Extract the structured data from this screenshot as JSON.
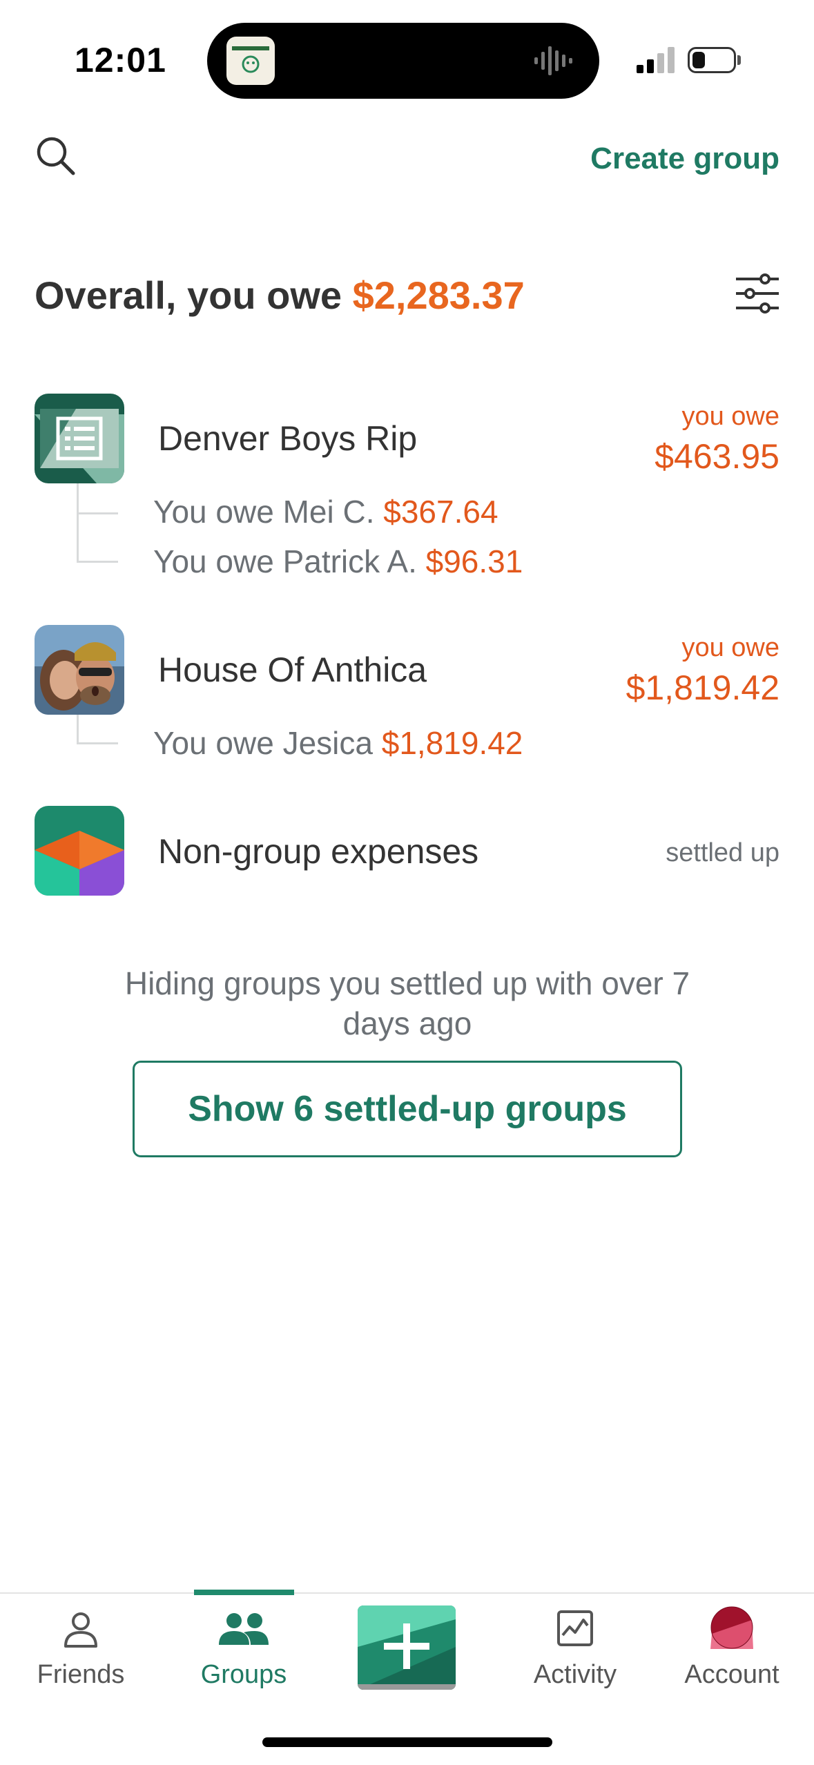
{
  "status_bar": {
    "time": "12:01"
  },
  "top_bar": {
    "create_group": "Create group",
    "search_icon": "search-icon"
  },
  "summary": {
    "label": "Overall, you owe",
    "amount": "$2,283.37",
    "filter_icon": "filter-sliders-icon"
  },
  "groups": [
    {
      "name": "Denver Boys Rip",
      "status_label": "you owe",
      "amount": "$463.95",
      "debts": [
        {
          "text": "You owe Mei C.",
          "amount": "$367.64"
        },
        {
          "text": "You owe Patrick A.",
          "amount": "$96.31"
        }
      ]
    },
    {
      "name": "House Of Anthica",
      "status_label": "you owe",
      "amount": "$1,819.42",
      "debts": [
        {
          "text": "You owe Jesica",
          "amount": "$1,819.42"
        }
      ]
    },
    {
      "name": "Non-group expenses",
      "status_label": "settled up"
    }
  ],
  "hiding_notice": "Hiding groups you settled up with over 7 days ago",
  "show_settled_button": "Show 6 settled-up groups",
  "nav": {
    "items": [
      {
        "label": "Friends",
        "icon": "person-icon"
      },
      {
        "label": "Groups",
        "icon": "group-icon",
        "active": true
      },
      {
        "label": "",
        "icon": "plus-icon"
      },
      {
        "label": "Activity",
        "icon": "activity-chart-icon"
      },
      {
        "label": "Account",
        "icon": "avatar"
      }
    ]
  },
  "colors": {
    "brand_green": "#1f7a63",
    "owe_orange": "#e2581c"
  }
}
